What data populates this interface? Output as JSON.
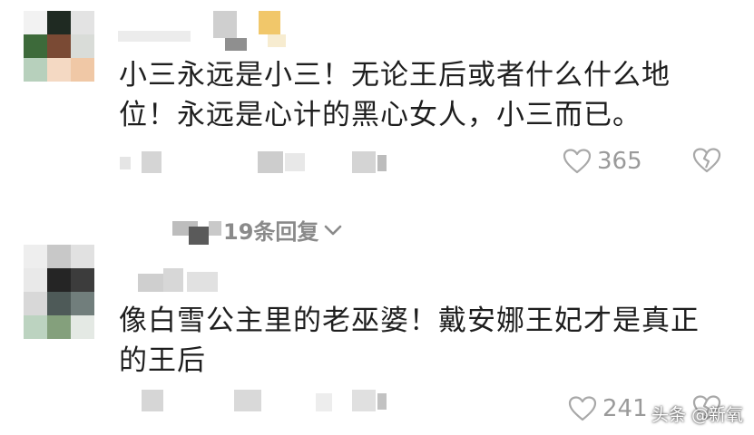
{
  "comments": [
    {
      "text_line1": "小三永远是小三！无论王后或者什么什么地",
      "text_line2": "位！永远是心计的黑心女人，小三而已。",
      "like_count": "365"
    },
    {
      "text_line1": "像白雪公主里的老巫婆！戴安娜王妃才是真正",
      "text_line2": "的王后",
      "like_count": "241"
    }
  ],
  "replies_link": {
    "label": "19条回复"
  },
  "watermark": "头条 @新氧",
  "icons": {
    "like": "heart-outline-icon",
    "dislike": "broken-heart-icon",
    "expand": "chevron-down-icon"
  },
  "colors": {
    "text": "#1e1e1e",
    "muted": "#9a9a9a",
    "icon": "#a8a8a8"
  }
}
